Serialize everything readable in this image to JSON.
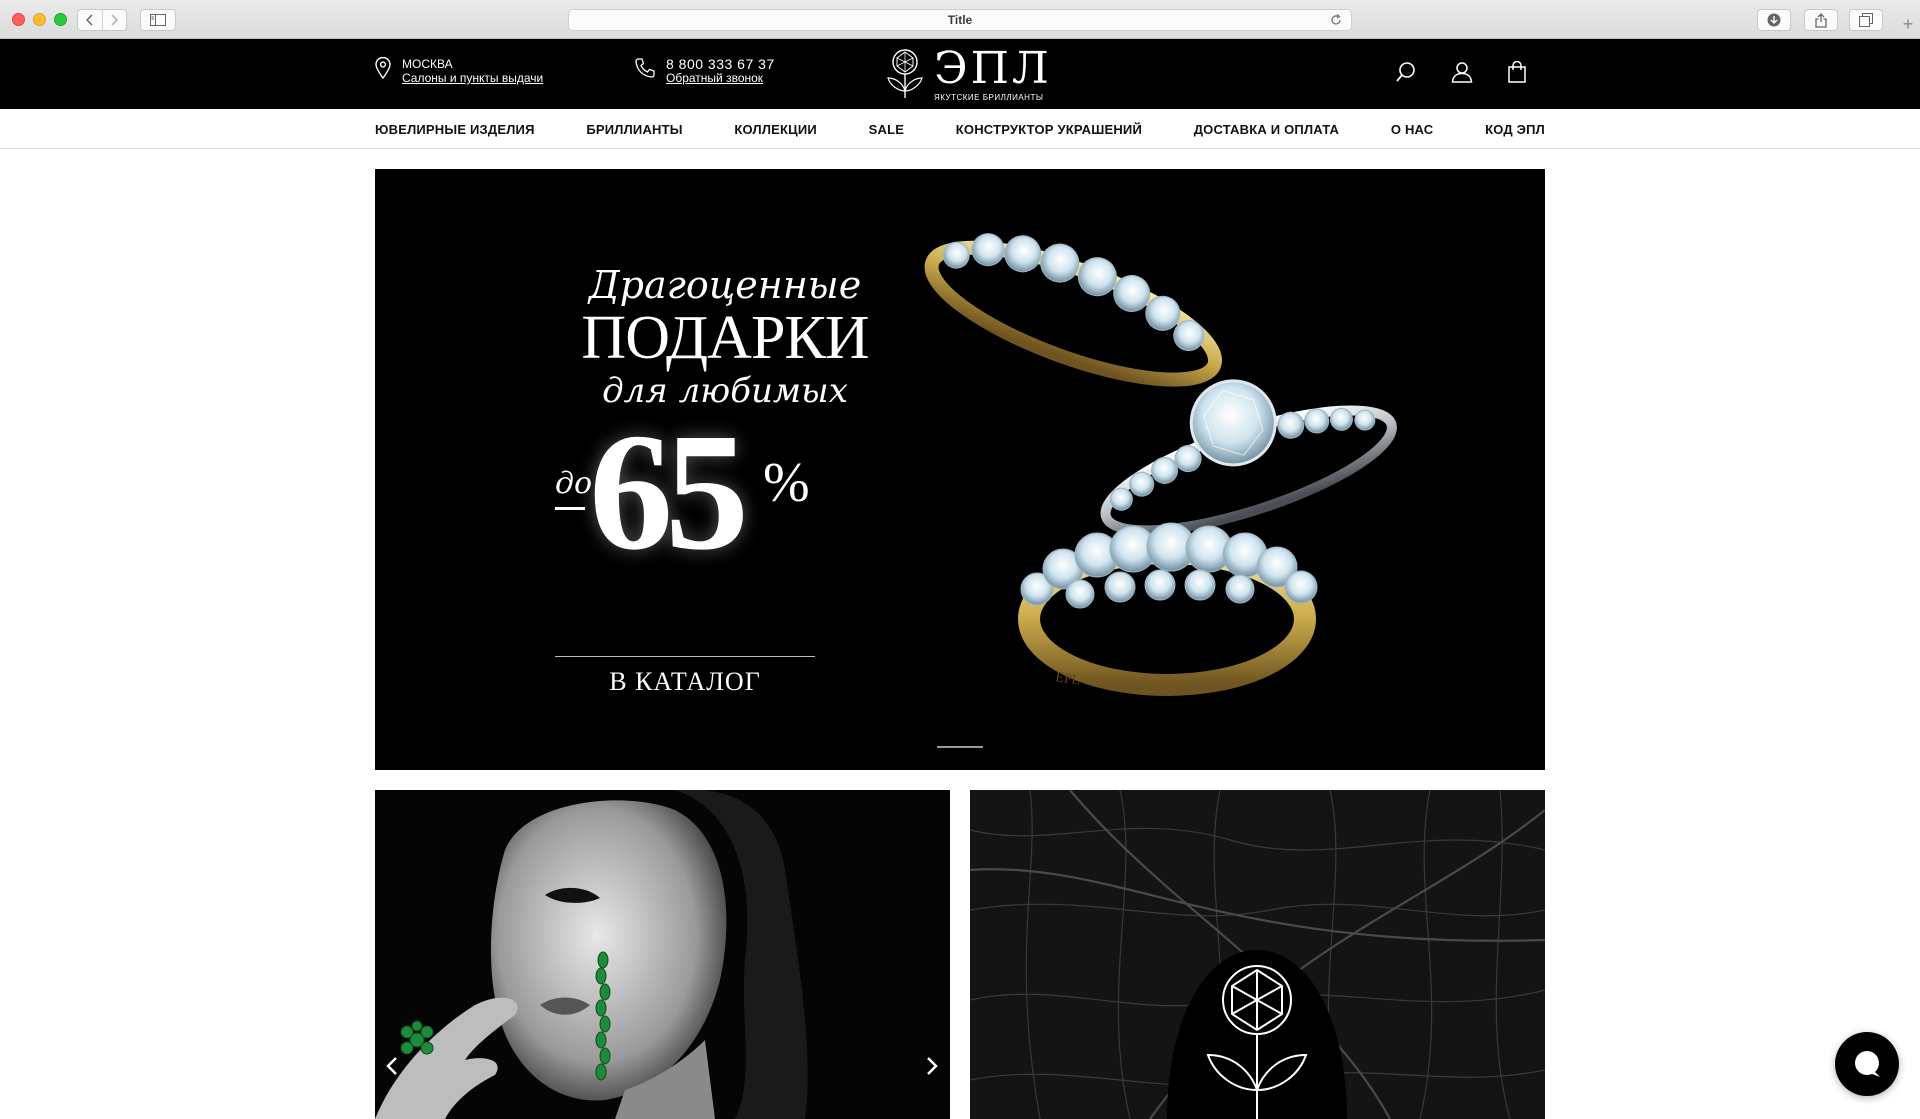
{
  "browser": {
    "title": "Title"
  },
  "header": {
    "city": "МОСКВА",
    "stores_link": "Салоны и пункты выдачи",
    "phone": "8 800 333 67 37",
    "callback_link": "Обратный звонок",
    "logo_word": "ЭПЛ",
    "logo_tagline": "ЯКУТСКИЕ БРИЛЛИАНТЫ"
  },
  "nav": {
    "items": [
      "ЮВЕЛИРНЫЕ ИЗДЕЛИЯ",
      "БРИЛЛИАНТЫ",
      "КОЛЛЕКЦИИ",
      "SALE",
      "КОНСТРУКТОР УКРАШЕНИЙ",
      "ДОСТАВКА И ОПЛАТА",
      "О НАС",
      "КОД ЭПЛ"
    ]
  },
  "hero": {
    "line1": "Драгоценные",
    "line2": "ПОДАРКИ",
    "line3": "для любимых",
    "prefix": "до",
    "discount_number": "65",
    "percent_sign": "%",
    "cta": "В КАТАЛОГ",
    "ring_engraving": "EPL"
  },
  "colors": {
    "header_bg": "#000000",
    "nav_bg": "#ffffff",
    "hero_bg": "#000000",
    "gold": "#c9a94a",
    "emerald": "#1f8a3a"
  },
  "icons": {
    "location": "location-pin-icon",
    "phone": "phone-icon",
    "search": "search-icon",
    "account": "user-icon",
    "cart": "shopping-bag-icon",
    "chat": "chat-icon",
    "prev": "chevron-left-icon",
    "next": "chevron-right-icon"
  }
}
